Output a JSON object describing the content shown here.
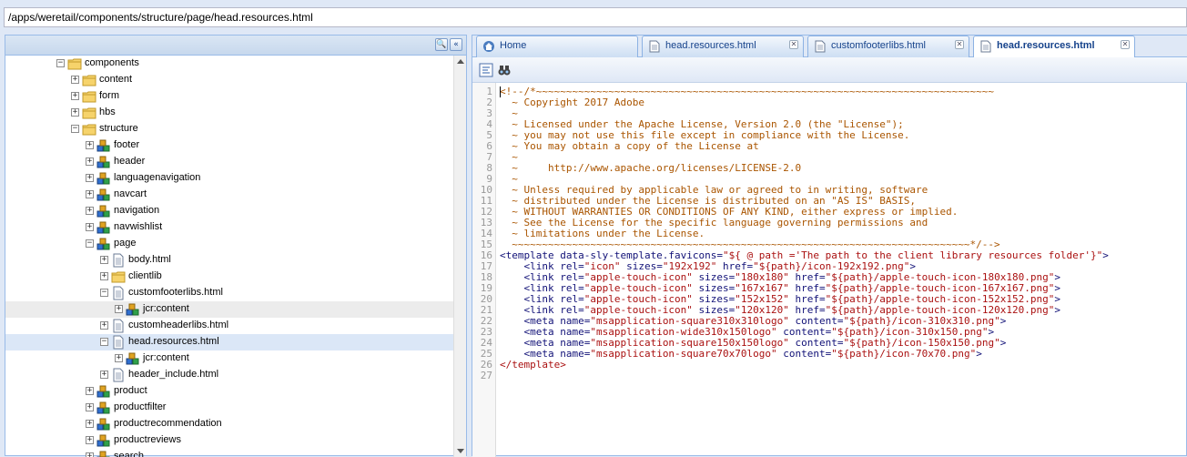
{
  "address": "/apps/weretail/components/structure/page/head.resources.html",
  "tree": [
    {
      "label": "components",
      "type": "folder",
      "state": "open"
    },
    {
      "label": "content",
      "type": "folder",
      "state": "closed"
    },
    {
      "label": "form",
      "type": "folder",
      "state": "closed"
    },
    {
      "label": "hbs",
      "type": "folder",
      "state": "closed"
    },
    {
      "label": "structure",
      "type": "folder",
      "state": "open"
    },
    {
      "label": "footer",
      "type": "component",
      "state": "closed"
    },
    {
      "label": "header",
      "type": "component",
      "state": "closed"
    },
    {
      "label": "languagenavigation",
      "type": "component",
      "state": "closed"
    },
    {
      "label": "navcart",
      "type": "component",
      "state": "closed"
    },
    {
      "label": "navigation",
      "type": "component",
      "state": "closed"
    },
    {
      "label": "navwishlist",
      "type": "component",
      "state": "closed"
    },
    {
      "label": "page",
      "type": "component",
      "state": "open"
    },
    {
      "label": "body.html",
      "type": "file",
      "state": "closed"
    },
    {
      "label": "clientlib",
      "type": "folder",
      "state": "closed"
    },
    {
      "label": "customfooterlibs.html",
      "type": "file",
      "state": "open"
    },
    {
      "label": "jcr:content",
      "type": "component",
      "state": "closed"
    },
    {
      "label": "customheaderlibs.html",
      "type": "file",
      "state": "closed"
    },
    {
      "label": "head.resources.html",
      "type": "file",
      "state": "open"
    },
    {
      "label": "jcr:content",
      "type": "component",
      "state": "closed"
    },
    {
      "label": "header_include.html",
      "type": "file",
      "state": "closed"
    },
    {
      "label": "product",
      "type": "component",
      "state": "closed"
    },
    {
      "label": "productfilter",
      "type": "component",
      "state": "closed"
    },
    {
      "label": "productrecommendation",
      "type": "component",
      "state": "closed"
    },
    {
      "label": "productreviews",
      "type": "component",
      "state": "closed"
    },
    {
      "label": "search",
      "type": "component",
      "state": "closed"
    }
  ],
  "tabs": [
    {
      "label": "Home",
      "icon": "home-icon",
      "closable": false,
      "active": false
    },
    {
      "label": "head.resources.html",
      "icon": "file-icon",
      "closable": true,
      "active": false
    },
    {
      "label": "customfooterlibs.html",
      "icon": "file-icon",
      "closable": true,
      "active": false
    },
    {
      "label": "head.resources.html",
      "icon": "file-icon",
      "closable": true,
      "active": true
    }
  ],
  "line_numbers": [
    "1",
    "2",
    "3",
    "4",
    "5",
    "6",
    "7",
    "8",
    "9",
    "10",
    "11",
    "12",
    "13",
    "14",
    "15",
    "16",
    "17",
    "18",
    "19",
    "20",
    "21",
    "22",
    "23",
    "24",
    "25",
    "26",
    "27"
  ],
  "code": [
    [
      {
        "t": "<!--/*~~~~~~~~~~~~~~~~~~~~~~~~~~~~~~~~~~~~~~~~~~~~~~~~~~~~~~~~~~~~~~~~~~~~~~~~~~~~",
        "c": "c-comment"
      }
    ],
    [
      {
        "t": "  ~ Copyright 2017 Adobe",
        "c": "c-comment"
      }
    ],
    [
      {
        "t": "  ~",
        "c": "c-comment"
      }
    ],
    [
      {
        "t": "  ~ Licensed under the Apache License, Version 2.0 (the \"License\");",
        "c": "c-comment"
      }
    ],
    [
      {
        "t": "  ~ you may not use this file except in compliance with the License.",
        "c": "c-comment"
      }
    ],
    [
      {
        "t": "  ~ You may obtain a copy of the License at",
        "c": "c-comment"
      }
    ],
    [
      {
        "t": "  ~",
        "c": "c-comment"
      }
    ],
    [
      {
        "t": "  ~     http://www.apache.org/licenses/LICENSE-2.0",
        "c": "c-comment"
      }
    ],
    [
      {
        "t": "  ~",
        "c": "c-comment"
      }
    ],
    [
      {
        "t": "  ~ Unless required by applicable law or agreed to in writing, software",
        "c": "c-comment"
      }
    ],
    [
      {
        "t": "  ~ distributed under the License is distributed on an \"AS IS\" BASIS,",
        "c": "c-comment"
      }
    ],
    [
      {
        "t": "  ~ WITHOUT WARRANTIES OR CONDITIONS OF ANY KIND, either express or implied.",
        "c": "c-comment"
      }
    ],
    [
      {
        "t": "  ~ See the License for the specific language governing permissions and",
        "c": "c-comment"
      }
    ],
    [
      {
        "t": "  ~ limitations under the License.",
        "c": "c-comment"
      }
    ],
    [
      {
        "t": "  ~~~~~~~~~~~~~~~~~~~~~~~~~~~~~~~~~~~~~~~~~~~~~~~~~~~~~~~~~~~~~~~~~~~~~~~~~~~~*/-->",
        "c": "c-comment"
      }
    ],
    [
      {
        "t": "<template data-sly-template.favicons=",
        "c": "c-tag"
      },
      {
        "t": "\"${ @ path ='The path to the client library resources folder'}\"",
        "c": "c-str"
      },
      {
        "t": ">",
        "c": "c-tag"
      }
    ],
    [
      {
        "t": "    <link rel=",
        "c": "c-tag"
      },
      {
        "t": "\"icon\"",
        "c": "c-str"
      },
      {
        "t": " sizes=",
        "c": "c-tag"
      },
      {
        "t": "\"192x192\"",
        "c": "c-str"
      },
      {
        "t": " href=",
        "c": "c-tag"
      },
      {
        "t": "\"${path}/icon-192x192.png\"",
        "c": "c-str"
      },
      {
        "t": ">",
        "c": "c-tag"
      }
    ],
    [
      {
        "t": "    <link rel=",
        "c": "c-tag"
      },
      {
        "t": "\"apple-touch-icon\"",
        "c": "c-str"
      },
      {
        "t": " sizes=",
        "c": "c-tag"
      },
      {
        "t": "\"180x180\"",
        "c": "c-str"
      },
      {
        "t": " href=",
        "c": "c-tag"
      },
      {
        "t": "\"${path}/apple-touch-icon-180x180.png\"",
        "c": "c-str"
      },
      {
        "t": ">",
        "c": "c-tag"
      }
    ],
    [
      {
        "t": "    <link rel=",
        "c": "c-tag"
      },
      {
        "t": "\"apple-touch-icon\"",
        "c": "c-str"
      },
      {
        "t": " sizes=",
        "c": "c-tag"
      },
      {
        "t": "\"167x167\"",
        "c": "c-str"
      },
      {
        "t": " href=",
        "c": "c-tag"
      },
      {
        "t": "\"${path}/apple-touch-icon-167x167.png\"",
        "c": "c-str"
      },
      {
        "t": ">",
        "c": "c-tag"
      }
    ],
    [
      {
        "t": "    <link rel=",
        "c": "c-tag"
      },
      {
        "t": "\"apple-touch-icon\"",
        "c": "c-str"
      },
      {
        "t": " sizes=",
        "c": "c-tag"
      },
      {
        "t": "\"152x152\"",
        "c": "c-str"
      },
      {
        "t": " href=",
        "c": "c-tag"
      },
      {
        "t": "\"${path}/apple-touch-icon-152x152.png\"",
        "c": "c-str"
      },
      {
        "t": ">",
        "c": "c-tag"
      }
    ],
    [
      {
        "t": "    <link rel=",
        "c": "c-tag"
      },
      {
        "t": "\"apple-touch-icon\"",
        "c": "c-str"
      },
      {
        "t": " sizes=",
        "c": "c-tag"
      },
      {
        "t": "\"120x120\"",
        "c": "c-str"
      },
      {
        "t": " href=",
        "c": "c-tag"
      },
      {
        "t": "\"${path}/apple-touch-icon-120x120.png\"",
        "c": "c-str"
      },
      {
        "t": ">",
        "c": "c-tag"
      }
    ],
    [
      {
        "t": "    <meta name=",
        "c": "c-tag"
      },
      {
        "t": "\"msapplication-square310x310logo\"",
        "c": "c-str"
      },
      {
        "t": " content=",
        "c": "c-tag"
      },
      {
        "t": "\"${path}/icon-310x310.png\"",
        "c": "c-str"
      },
      {
        "t": ">",
        "c": "c-tag"
      }
    ],
    [
      {
        "t": "    <meta name=",
        "c": "c-tag"
      },
      {
        "t": "\"msapplication-wide310x150logo\"",
        "c": "c-str"
      },
      {
        "t": " content=",
        "c": "c-tag"
      },
      {
        "t": "\"${path}/icon-310x150.png\"",
        "c": "c-str"
      },
      {
        "t": ">",
        "c": "c-tag"
      }
    ],
    [
      {
        "t": "    <meta name=",
        "c": "c-tag"
      },
      {
        "t": "\"msapplication-square150x150logo\"",
        "c": "c-str"
      },
      {
        "t": " content=",
        "c": "c-tag"
      },
      {
        "t": "\"${path}/icon-150x150.png\"",
        "c": "c-str"
      },
      {
        "t": ">",
        "c": "c-tag"
      }
    ],
    [
      {
        "t": "    <meta name=",
        "c": "c-tag"
      },
      {
        "t": "\"msapplication-square70x70logo\"",
        "c": "c-str"
      },
      {
        "t": " content=",
        "c": "c-tag"
      },
      {
        "t": "\"${path}/icon-70x70.png\"",
        "c": "c-str"
      },
      {
        "t": ">",
        "c": "c-tag"
      }
    ],
    [
      {
        "t": "</template>",
        "c": "c-endtag"
      }
    ],
    []
  ]
}
